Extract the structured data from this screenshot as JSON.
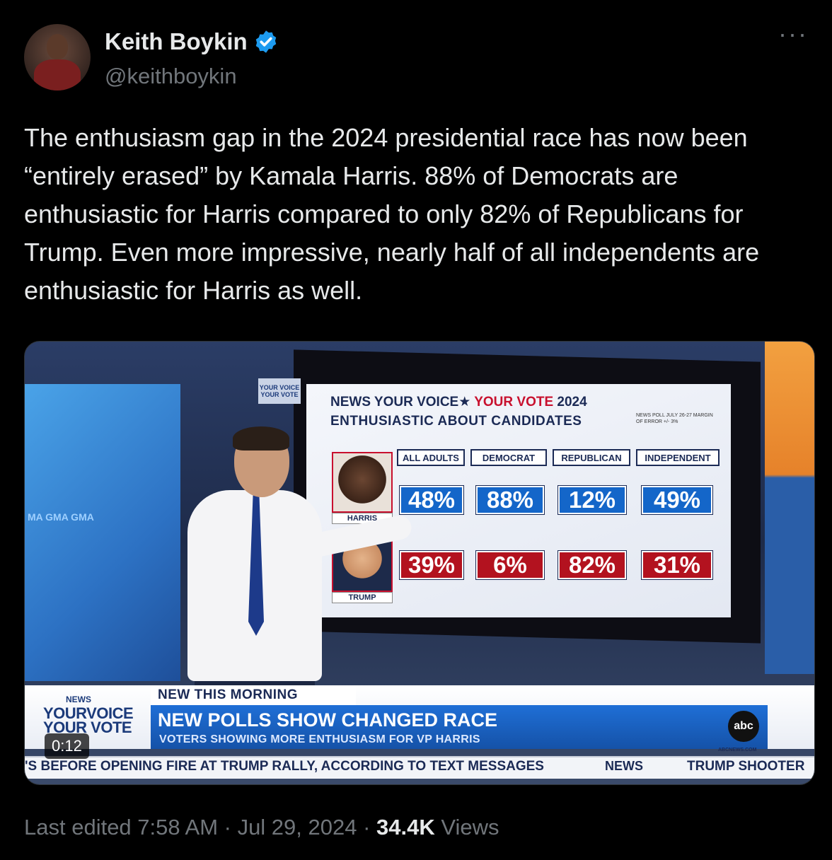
{
  "author": {
    "name": "Keith Boykin",
    "handle": "@keithboykin",
    "verified": true,
    "verified_color": "#1d9bf0"
  },
  "icons": {
    "more": "more-icon",
    "verified": "verified-badge-icon"
  },
  "more_label": "···",
  "tweet": {
    "text": "The enthusiasm gap in the 2024 presidential race has now been “entirely erased” by Kamala Harris. 88% of Democrats are enthusiastic for Harris compared to only 82% of Republicans for Trump. Even more impressive, nearly half of all independents are enthusiastic for Harris as well."
  },
  "video": {
    "duration": "0:12",
    "board": {
      "logo_text": "YOUR VOICE YOUR VOTE",
      "title_left": "NEWS YOUR VOICE★",
      "title_right": "YOUR VOTE",
      "title_year": "2024",
      "subtitle": "ENTHUSIASTIC ABOUT CANDIDATES",
      "note": "NEWS POLL JULY 26-27 MARGIN OF ERROR +/- 3%",
      "columns": [
        "ALL ADULTS",
        "DEMOCRAT",
        "REPUBLICAN",
        "INDEPENDENT"
      ],
      "candidates": [
        {
          "label": "HARRIS",
          "values": [
            "48%",
            "88%",
            "12%",
            "49%"
          ]
        },
        {
          "label": "TRUMP",
          "values": [
            "39%",
            "6%",
            "82%",
            "31%"
          ]
        }
      ]
    },
    "left_screen_text": "MA GMA GMA",
    "lower_third": {
      "logo_small": "NEWS",
      "logo_line1": "YOURVOICE",
      "logo_line2": "YOUR VOTE",
      "tag": "NEW THIS MORNING",
      "headline": "NEW POLLS SHOW CHANGED RACE",
      "subhead": "VOTERS SHOWING MORE ENTHUSIASM FOR VP HARRIS",
      "network_logo": "abc",
      "network_url": "ABCNEWS.COM"
    },
    "ticker": {
      "text": "'S BEFORE OPENING FIRE AT TRUMP RALLY, ACCORDING TO TEXT MESSAGES",
      "news": "NEWS",
      "right": "TRUMP SHOOTER"
    }
  },
  "footer": {
    "edited": "Last edited 7:58 AM · Jul 29, 2024 · ",
    "views_count": "34.4K",
    "views_label": " Views"
  }
}
